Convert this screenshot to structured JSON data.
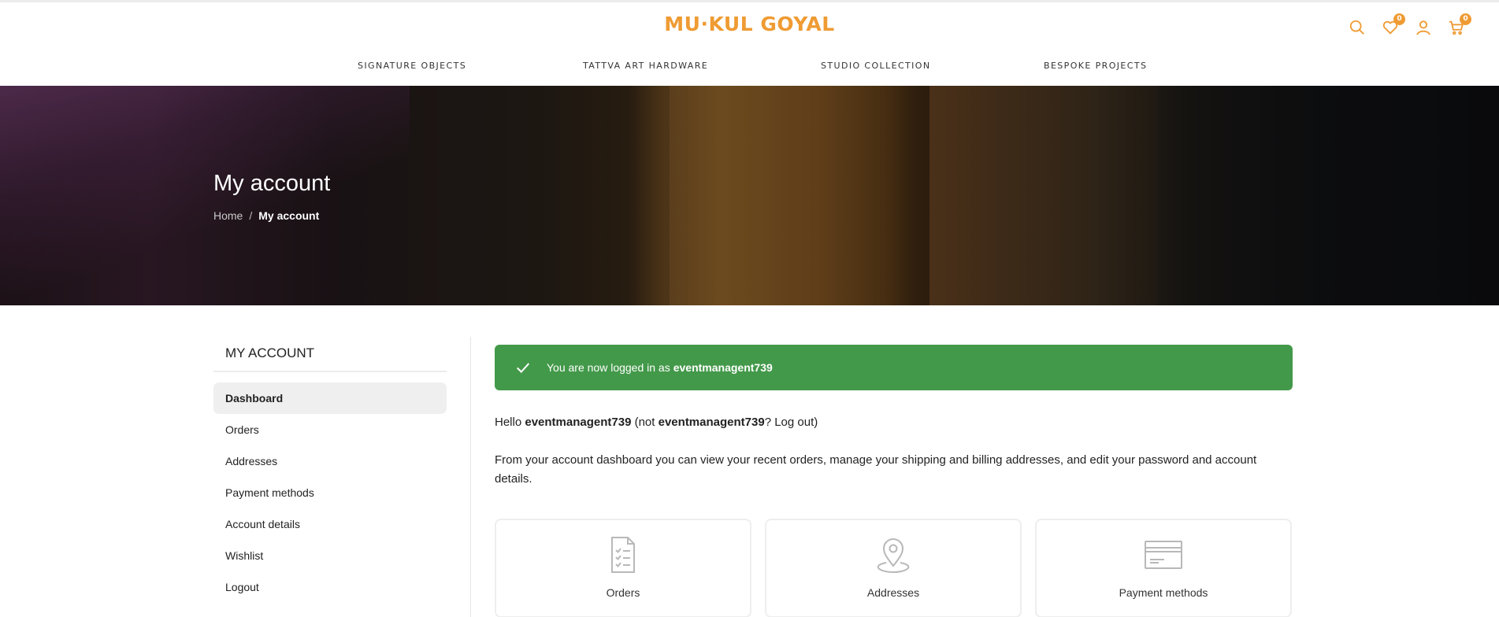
{
  "brand": {
    "logo": "MU·KUL GOYAL",
    "accent": "#ef9b33"
  },
  "header": {
    "icons": [
      "search-icon",
      "heart-icon",
      "user-icon",
      "cart-icon"
    ],
    "wishlist_count": "0",
    "cart_count": "0"
  },
  "nav": {
    "items": [
      {
        "label": "SIGNATURE OBJECTS"
      },
      {
        "label": "TATTVA ART HARDWARE"
      },
      {
        "label": "STUDIO COLLECTION"
      },
      {
        "label": "BESPOKE PROJECTS"
      }
    ]
  },
  "hero": {
    "title": "My account",
    "breadcrumb": {
      "home": "Home",
      "separator": "/",
      "current": "My account"
    }
  },
  "sidebar": {
    "title": "MY ACCOUNT",
    "items": [
      {
        "label": "Dashboard",
        "active": true
      },
      {
        "label": "Orders"
      },
      {
        "label": "Addresses"
      },
      {
        "label": "Payment methods"
      },
      {
        "label": "Account details"
      },
      {
        "label": "Wishlist"
      },
      {
        "label": "Logout"
      }
    ]
  },
  "main": {
    "notice": {
      "prefix": "You are now logged in as",
      "username": "eventmanagent739",
      "color": "#43994a"
    },
    "hello": {
      "greeting": "Hello",
      "username": "eventmanagent739",
      "not_open": "(not",
      "not_username": "eventmanagent739",
      "question": "?",
      "logout": "Log out",
      "close": ")"
    },
    "description": "From your account dashboard you can view your recent orders, manage your shipping and billing addresses, and edit your password and account details.",
    "cards": [
      {
        "label": "Orders",
        "icon": "orders-icon"
      },
      {
        "label": "Addresses",
        "icon": "location-pin-icon"
      },
      {
        "label": "Payment methods",
        "icon": "credit-card-icon"
      }
    ]
  }
}
